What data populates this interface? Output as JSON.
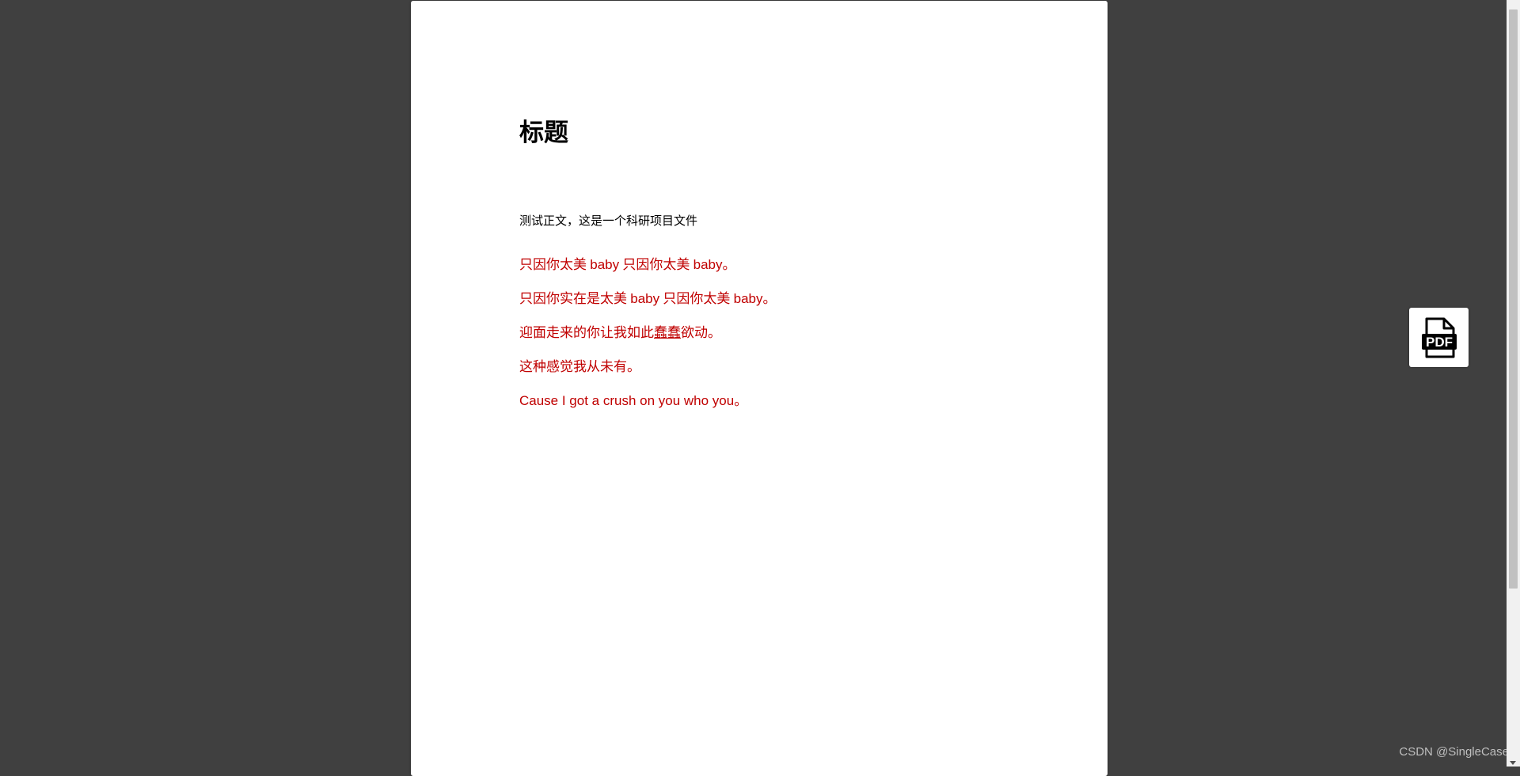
{
  "document": {
    "title": "标题",
    "body": "测试正文，这是一个科研项目文件",
    "lyrics": [
      {
        "text1": "只因你太美 ",
        "latin1": "baby",
        "text2": " 只因你太美 ",
        "latin2": "baby",
        "text3": "。"
      },
      {
        "text1": "只因你实在是太美 ",
        "latin1": "baby",
        "text2": " 只因你太美 ",
        "latin2": "baby",
        "text3": "。"
      },
      {
        "before": "迎面走来的你让我如此",
        "underlined": "蠢蠢",
        "after": "欲动。"
      },
      {
        "text": "这种感觉我从未有。"
      },
      {
        "latin": "Cause I got a crush on you who you",
        "end": "。"
      }
    ]
  },
  "pdf_button": {
    "icon": "pdf-file-icon",
    "label": "PDF"
  },
  "watermark": "CSDN @SingleCase",
  "colors": {
    "viewer_background": "#404040",
    "page_background": "#ffffff",
    "lyric_text": "#c00000",
    "body_text": "#000000"
  }
}
